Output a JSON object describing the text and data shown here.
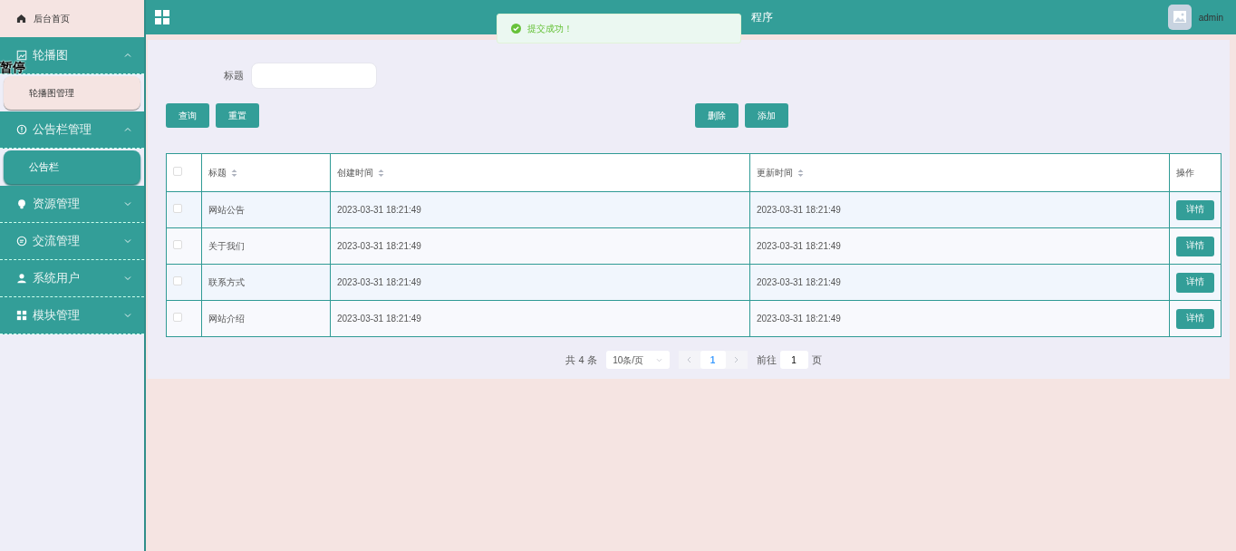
{
  "sidebar": {
    "home": {
      "label": "后台首页"
    },
    "groups": [
      {
        "label": "轮播图",
        "expanded": true,
        "children": [
          {
            "label": "轮播图管理",
            "selected": false
          }
        ]
      },
      {
        "label": "公告栏管理",
        "expanded": true,
        "children": [
          {
            "label": "公告栏",
            "selected": true
          }
        ]
      },
      {
        "label": "资源管理",
        "expanded": false
      },
      {
        "label": "交流管理",
        "expanded": false
      },
      {
        "label": "系统用户",
        "expanded": false
      },
      {
        "label": "模块管理",
        "expanded": false
      }
    ]
  },
  "overlay_label": "暂停",
  "header": {
    "title": "程序",
    "user": "admin"
  },
  "toast": {
    "message": "提交成功！"
  },
  "search": {
    "label": "标题",
    "buttons": [
      "查询",
      "重置"
    ],
    "actions": [
      "删除",
      "添加"
    ]
  },
  "table": {
    "select_all_checked": false,
    "columns": [
      {
        "label": "标题",
        "sortable": true
      },
      {
        "label": "创建时间",
        "sortable": true
      },
      {
        "label": "更新时间",
        "sortable": true
      },
      {
        "label": "操作",
        "sortable": false
      }
    ],
    "rows": [
      {
        "title": "网站公告",
        "created": "2023-03-31 18:21:49",
        "updated": "2023-03-31 18:21:49",
        "action": "详情",
        "checked": false
      },
      {
        "title": "关于我们",
        "created": "2023-03-31 18:21:49",
        "updated": "2023-03-31 18:21:49",
        "action": "详情",
        "checked": false
      },
      {
        "title": "联系方式",
        "created": "2023-03-31 18:21:49",
        "updated": "2023-03-31 18:21:49",
        "action": "详情",
        "checked": false
      },
      {
        "title": "网站介绍",
        "created": "2023-03-31 18:21:49",
        "updated": "2023-03-31 18:21:49",
        "action": "详情",
        "checked": false
      }
    ]
  },
  "pagination": {
    "total": "共 4 条",
    "page_size": "10条/页",
    "pages": [
      {
        "label": "1",
        "selected": true
      }
    ],
    "goto_label": "前往",
    "goto_value": "1",
    "goto_suffix": "页"
  }
}
